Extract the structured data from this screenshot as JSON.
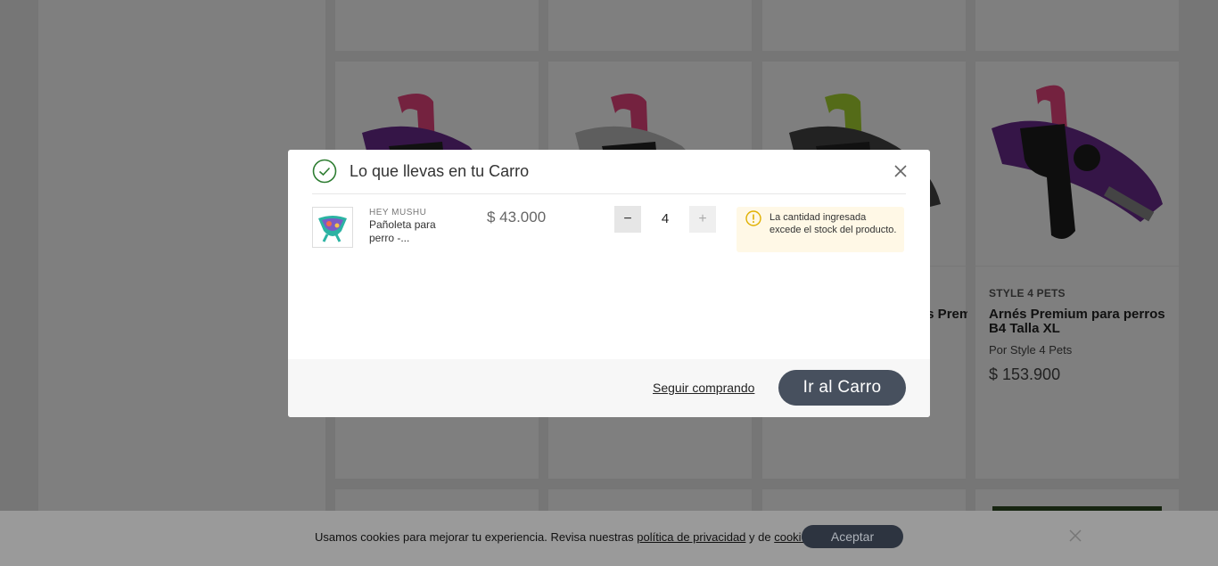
{
  "background": {
    "products": [
      {
        "brand": "",
        "name": "",
        "by": "",
        "price": "",
        "strap_color": "#e8457f",
        "body_color": "#6a2b8e"
      },
      {
        "brand": "",
        "name": "",
        "by": "",
        "price": "",
        "strap_color": "#e8457f",
        "body_color": "#9a9a9a"
      },
      {
        "brand": "",
        "name": "Arnés Premium para perros",
        "by": "",
        "price": "",
        "strap_color": "#a9d631",
        "body_color": "#444444"
      },
      {
        "brand": "STYLE 4 PETS",
        "name": "Arnés Premium para perros B4 Talla XL",
        "by": "Por Style 4 Pets",
        "price": "$ 153.900",
        "strap_color": "#e8457f",
        "body_color": "#6a2b8e"
      }
    ]
  },
  "modal": {
    "title": "Lo que llevas en tu Carro",
    "item": {
      "brand": "HEY MUSHU",
      "name": "Pañoleta para perro -...",
      "price": "$ 43.000",
      "quantity": "4",
      "minus_label": "−",
      "plus_label": "+"
    },
    "warning": "La cantidad ingresada excede el stock del producto.",
    "continue_label": "Seguir comprando",
    "go_cart_label": "Ir al Carro"
  },
  "cookies": {
    "text_before": "Usamos cookies para mejorar tu experiencia. Revisa nuestras ",
    "privacy_link": "política de privacidad",
    "text_middle": " y de ",
    "cookies_link": "cookies",
    "text_after": ".",
    "accept_label": "Aceptar"
  },
  "colors": {
    "success": "#2e7d32",
    "warning": "#e0b000",
    "button_dark": "#47505e"
  }
}
